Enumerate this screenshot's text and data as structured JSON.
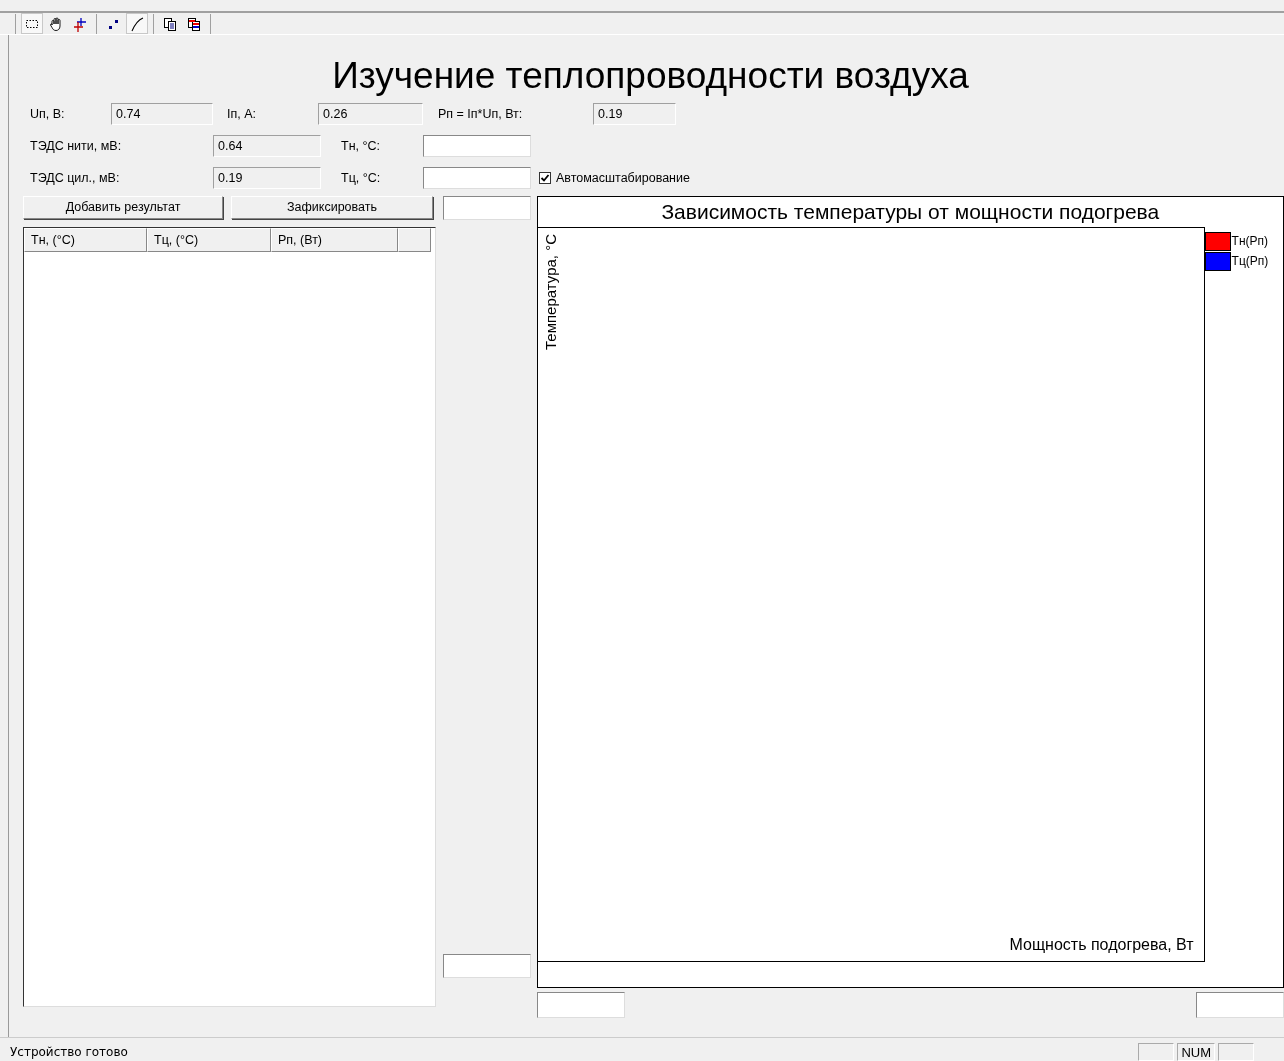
{
  "toolbar": [
    {
      "kind": "select",
      "pressed": true
    },
    {
      "kind": "hand",
      "pressed": false
    },
    {
      "kind": "crosshair",
      "pressed": false
    },
    {
      "kind": "points",
      "pressed": false
    },
    {
      "kind": "line",
      "pressed": true
    },
    {
      "kind": "copy",
      "pressed": false
    },
    {
      "kind": "copy-color",
      "pressed": false
    }
  ],
  "title": "Изучение теплопроводности воздуха",
  "rows": [
    [
      {
        "kind": "field",
        "label": "Uп, В:",
        "value": "0.74",
        "readonly": true
      },
      {
        "kind": "field",
        "label": "Iп, А:",
        "value": "0.26",
        "readonly": true
      },
      {
        "kind": "field",
        "label": "Рп = Iп*Uп, Вт:",
        "value": "0.19",
        "readonly": true
      }
    ],
    [
      {
        "kind": "field",
        "label": "ТЭДС нити, мВ:",
        "value": "0.64",
        "readonly": true
      },
      {
        "kind": "field",
        "label": "Тн, °С:",
        "readonly": false
      }
    ],
    [
      {
        "kind": "field",
        "label": "ТЭДС цил., мВ:",
        "value": "0.19",
        "readonly": true
      },
      {
        "kind": "field",
        "label": "Тц, °С:",
        "readonly": false
      },
      {
        "kind": "checkbox",
        "label": "Автомасштабирование",
        "checked": true
      }
    ]
  ],
  "buttons": [
    "Добавить результат",
    "Зафиксировать"
  ],
  "table": {
    "columns": [
      "Тн, (°С)",
      "Тц, (°С)",
      "Рп, (Вт)"
    ]
  },
  "chart": {
    "title": "Зависимость температуры от мощности подогрева",
    "ylabel": "Температура, °С",
    "xlabel": "Мощность подогрева, Вт",
    "legend": [
      {
        "label": "Тн(Рп)",
        "color": "#ff0000"
      },
      {
        "label": "Тц(Рп)",
        "color": "#0000ff"
      }
    ]
  },
  "status_bar": {
    "text": "Устройство готово",
    "indicators": [
      "NUM"
    ]
  }
}
